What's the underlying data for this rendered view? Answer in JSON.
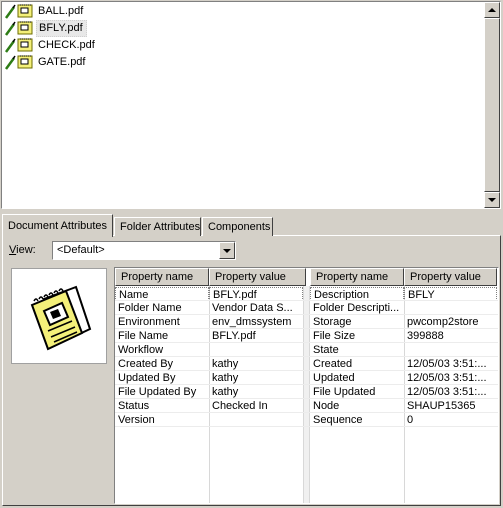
{
  "files": [
    {
      "name": "BALL.pdf",
      "selected": false
    },
    {
      "name": "BFLY.pdf",
      "selected": true
    },
    {
      "name": "CHECK.pdf",
      "selected": false
    },
    {
      "name": "GATE.pdf",
      "selected": false
    }
  ],
  "tabs": [
    {
      "label": "Document Attributes",
      "active": true
    },
    {
      "label": "Folder Attributes",
      "active": false
    },
    {
      "label": "Components",
      "active": false
    }
  ],
  "view": {
    "label_prefix": "",
    "label_underlined": "V",
    "label_rest": "iew:",
    "value": "<Default>"
  },
  "grid": {
    "headers": [
      "Property name",
      "Property value",
      "Property name",
      "Property value"
    ],
    "rows": [
      [
        "Name",
        "BFLY.pdf",
        "Description",
        "BFLY"
      ],
      [
        "Folder Name",
        "Vendor Data S...",
        "Folder Descripti...",
        ""
      ],
      [
        "Environment",
        "env_dmssystem",
        "Storage",
        "pwcomp2store"
      ],
      [
        "File Name",
        "BFLY.pdf",
        "File Size",
        "399888"
      ],
      [
        "Workflow",
        "",
        "State",
        ""
      ],
      [
        "Created By",
        "kathy",
        "Created",
        "12/05/03 3:51:..."
      ],
      [
        "Updated By",
        "kathy",
        "Updated",
        "12/05/03 3:51:..."
      ],
      [
        "File Updated By",
        "kathy",
        "File Updated",
        "12/05/03 3:51:..."
      ],
      [
        "Status",
        "Checked In",
        "Node",
        "SHAUP15365"
      ],
      [
        "Version",
        "",
        "Sequence",
        "0"
      ]
    ]
  }
}
